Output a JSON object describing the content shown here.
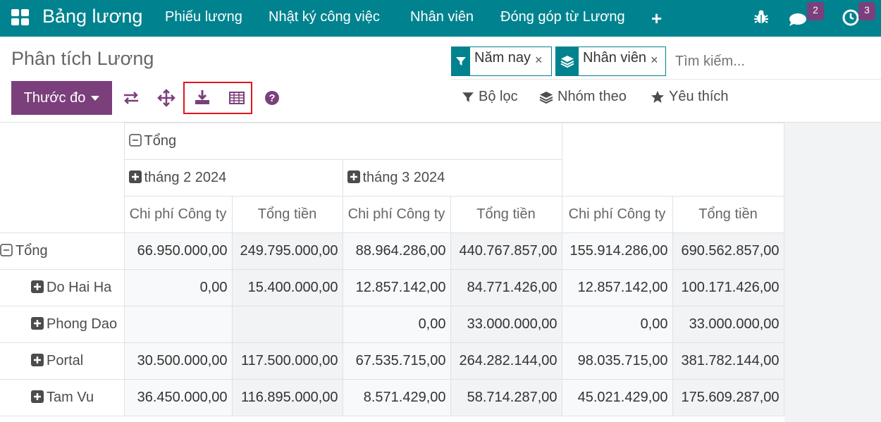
{
  "navbar": {
    "app_title": "Bảng lương",
    "menu": [
      "Phiếu lương",
      "Nhật ký công việc",
      "Nhân viên",
      "Đóng góp từ Lương"
    ],
    "chat_badge": "2",
    "activity_badge": "3"
  },
  "control_panel": {
    "title": "Phân tích Lương",
    "measure_button": "Thước đo",
    "facets": [
      "Năm nay",
      "Nhân viên"
    ],
    "search_placeholder": "Tìm kiếm...",
    "filter_label": "Bộ lọc",
    "group_label": "Nhóm theo",
    "favorite_label": "Yêu thích"
  },
  "pivot": {
    "col_total": "Tổng",
    "col_groups": [
      "tháng 2 2024",
      "tháng 3 2024"
    ],
    "measures": [
      "Chi phí Công ty",
      "Tổng tiền"
    ],
    "rows": [
      {
        "label": "Tổng",
        "values": [
          "66.950.000,00",
          "249.795.000,00",
          "88.964.286,00",
          "440.767.857,00",
          "155.914.286,00",
          "690.562.857,00"
        ]
      },
      {
        "label": "Do Hai Ha",
        "values": [
          "0,00",
          "15.400.000,00",
          "12.857.142,00",
          "84.771.426,00",
          "12.857.142,00",
          "100.171.426,00"
        ]
      },
      {
        "label": "Phong Dao",
        "values": [
          "",
          "",
          "0,00",
          "33.000.000,00",
          "0,00",
          "33.000.000,00"
        ]
      },
      {
        "label": "Portal",
        "values": [
          "30.500.000,00",
          "117.500.000,00",
          "67.535.715,00",
          "264.282.144,00",
          "98.035.715,00",
          "381.782.144,00"
        ]
      },
      {
        "label": "Tam Vu",
        "values": [
          "36.450.000,00",
          "116.895.000,00",
          "8.571.429,00",
          "58.714.287,00",
          "45.021.429,00",
          "175.609.287,00"
        ]
      }
    ]
  }
}
